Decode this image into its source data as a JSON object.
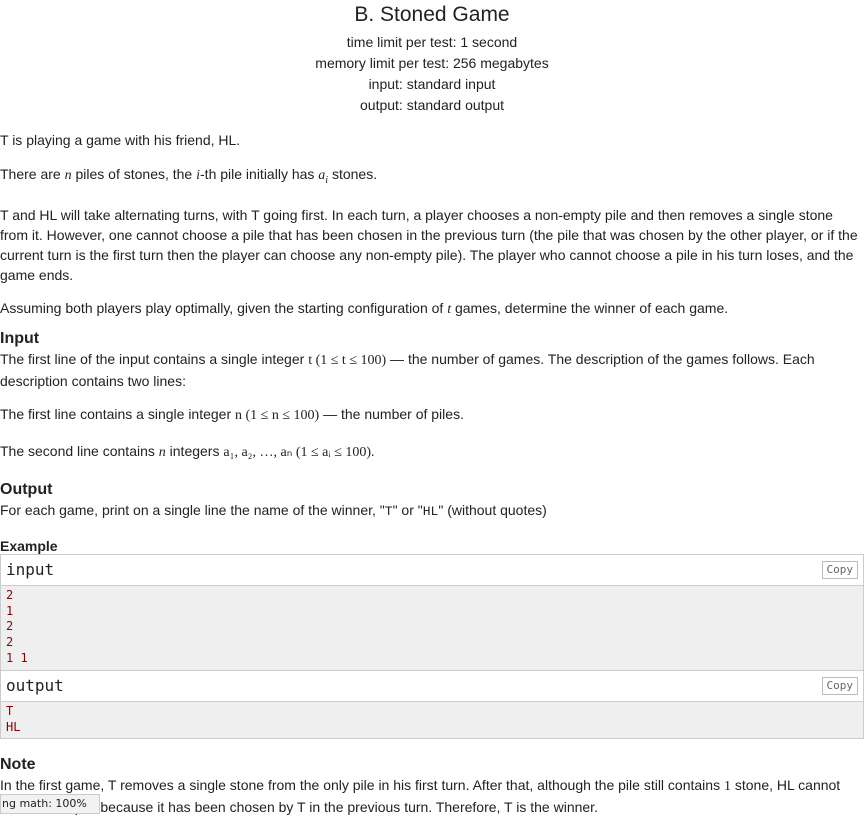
{
  "problem": {
    "title": "B. Stoned Game",
    "time_limit": "time limit per test: 1 second",
    "memory_limit": "memory limit per test: 256 megabytes",
    "input": "input: standard input",
    "output": "output: standard output"
  },
  "statement": {
    "p1": "T is playing a game with his friend, HL.",
    "p2_a": "There are ",
    "p2_n": "n",
    "p2_b": " piles of stones, the ",
    "p2_i": "i",
    "p2_c": "-th pile initially has ",
    "p2_ai": "a",
    "p2_sub": "i",
    "p2_d": " stones.",
    "p3": "T and HL will take alternating turns, with T going first. In each turn, a player chooses a non-empty pile and then removes a single stone from it. However, one cannot choose a pile that has been chosen in the previous turn (the pile that was chosen by the other player, or if the current turn is the first turn then the player can choose any non-empty pile). The player who cannot choose a pile in his turn loses, and the game ends.",
    "p4_a": "Assuming both players play optimally, given the starting configuration of ",
    "p4_t": "t",
    "p4_b": " games, determine the winner of each game."
  },
  "input_section": {
    "heading": "Input",
    "l1_a": "The first line of the input contains a single integer ",
    "l1_math": "t (1 ≤ t ≤ 100)",
    "l1_b": " — the number of games. The description of the games follows. Each description contains two lines:",
    "l2_a": "The first line contains a single integer ",
    "l2_math": "n (1 ≤ n ≤ 100)",
    "l2_b": " — the number of piles.",
    "l3_a": "The second line contains ",
    "l3_n": "n",
    "l3_b": " integers ",
    "l3_math": "a₁, a₂, …, aₙ (1 ≤ aᵢ ≤ 100).",
    "l3_c": ""
  },
  "output_section": {
    "heading": "Output",
    "text_a": "For each game, print on a single line the name of the winner, \"",
    "code_t": "T",
    "text_b": "\" or \"",
    "code_hl": "HL",
    "text_c": "\" (without quotes)"
  },
  "example": {
    "heading": "Example",
    "input_label": "input",
    "output_label": "output",
    "copy_label": "Copy",
    "input_lines": [
      "2",
      "1",
      "2",
      "2",
      "1 1"
    ],
    "output_lines": [
      "T",
      "HL"
    ]
  },
  "note": {
    "heading": "Note",
    "text_a": "In the first game, T removes a single stone from the only pile in his first turn. After that, although the pile still contains ",
    "one": "1",
    "text_b": " stone, HL cannot choose this pile because it has been chosen by T in the previous turn. Therefore, T is the winner."
  },
  "overlay": {
    "zoom_text": "ng math: 100%"
  }
}
